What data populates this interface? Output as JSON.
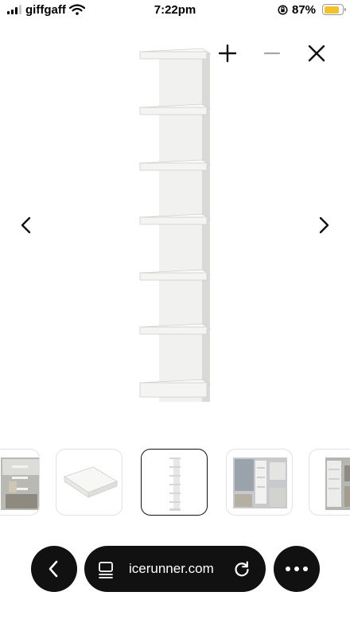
{
  "status_bar": {
    "carrier": "giffgaff",
    "time": "7:22pm",
    "battery_percent": "87%",
    "battery_level": 0.87,
    "signal_bars": 3
  },
  "viewer": {
    "zoom_in_icon": "plus-icon",
    "zoom_out_icon": "minus-icon",
    "close_icon": "close-icon",
    "prev_icon": "chevron-left-icon",
    "next_icon": "chevron-right-icon",
    "product_image": "white wall shelf unit"
  },
  "thumbnails": [
    {
      "name": "room-photo-1",
      "active": false
    },
    {
      "name": "shelf-detail",
      "active": false
    },
    {
      "name": "shelf-unit",
      "active": true
    },
    {
      "name": "room-photo-2",
      "active": false
    },
    {
      "name": "room-photo-3",
      "active": false
    }
  ],
  "browser": {
    "url": "icerunner.com",
    "back_icon": "chevron-left-icon",
    "page_icon": "page-settings-icon",
    "reload_icon": "reload-icon",
    "menu_icon": "more-icon"
  },
  "colors": {
    "battery": "#f2c12e",
    "bar": "#111111"
  }
}
